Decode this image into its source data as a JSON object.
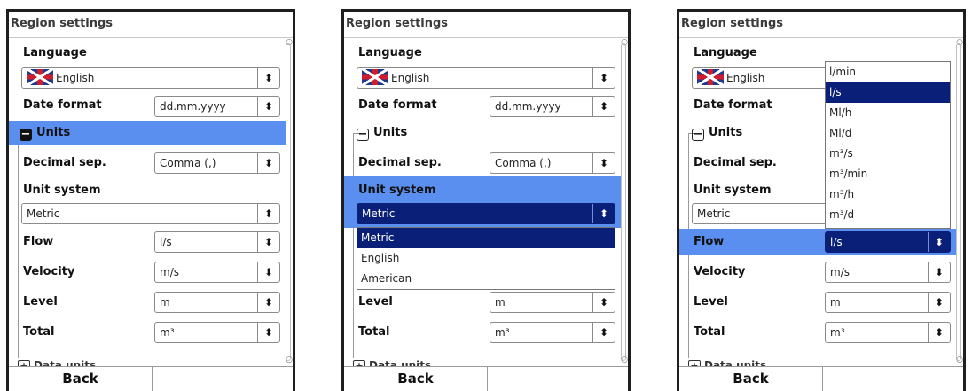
{
  "screens": [
    {
      "title": "Region settings",
      "language_label": "Language",
      "language_value": "English",
      "date_format_label": "Date format",
      "date_format_value": "dd.mm.yyyy",
      "units_label": "Units",
      "decimal_sep_label": "Decimal sep.",
      "decimal_sep_value": "Comma (,)",
      "unit_system_label": "Unit system",
      "unit_system_value": "Metric",
      "flow_label": "Flow",
      "flow_value": "l/s",
      "velocity_label": "Velocity",
      "velocity_value": "m/s",
      "level_label": "Level",
      "level_value": "m",
      "total_label": "Total",
      "total_value": "m³",
      "data_units_label": "Data units",
      "back_label": "Back"
    },
    {
      "title": "Region settings",
      "language_label": "Language",
      "language_value": "English",
      "date_format_label": "Date format",
      "date_format_value": "dd.mm.yyyy",
      "units_label": "Units",
      "decimal_sep_label": "Decimal sep.",
      "decimal_sep_value": "Comma (,)",
      "unit_system_label": "Unit system",
      "unit_system_value": "Metric",
      "unit_system_options": [
        "Metric",
        "English",
        "American"
      ],
      "level_label": "Level",
      "level_value": "m",
      "total_label": "Total",
      "total_value": "m³",
      "data_units_label": "Data units",
      "back_label": "Back"
    },
    {
      "title": "Region settings",
      "language_label": "Language",
      "language_value": "English",
      "date_format_label": "Date format",
      "units_label": "Units",
      "decimal_sep_label": "Decimal sep.",
      "unit_system_label": "Unit system",
      "unit_system_value": "Metric",
      "flow_label": "Flow",
      "flow_value": "l/s",
      "flow_options": [
        "l/min",
        "l/s",
        "Ml/h",
        "Ml/d",
        "m³/s",
        "m³/min",
        "m³/h",
        "m³/d"
      ],
      "velocity_label": "Velocity",
      "velocity_value": "m/s",
      "level_label": "Level",
      "level_value": "m",
      "total_label": "Total",
      "total_value": "m³",
      "data_units_label": "Data units",
      "back_label": "Back"
    }
  ],
  "colors": {
    "highlight": "#5b8fef",
    "selected": "#0a1f78"
  }
}
